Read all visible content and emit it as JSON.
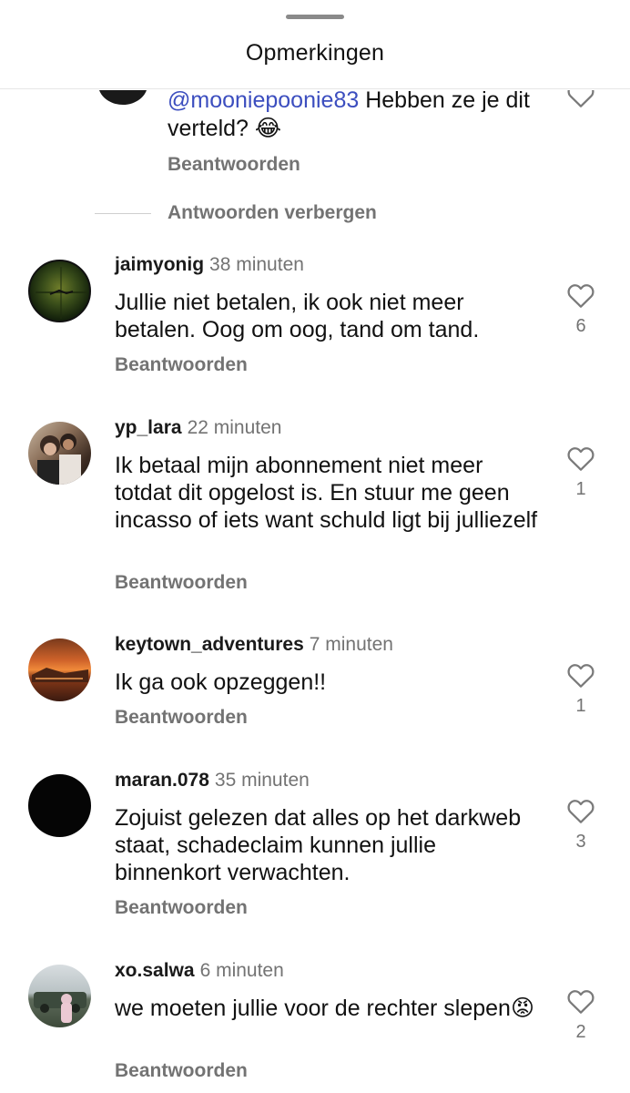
{
  "header": {
    "title": "Opmerkingen"
  },
  "reply": {
    "mention": "@mooniepoonie83",
    "text": " Hebben ze je dit verteld? 😂",
    "reply_label": "Beantwoorden",
    "hide_replies_label": "Antwoorden verbergen"
  },
  "comments": [
    {
      "user": "jaimyonig",
      "time": "38 minuten",
      "text": "Jullie niet betalen, ik ook niet meer betalen. Oog om oog, tand om tand.",
      "likes": "6",
      "reply_label": "Beantwoorden"
    },
    {
      "user": "yp_lara",
      "time": "22 minuten",
      "text": "Ik betaal mijn abonnement niet meer totdat dit opgelost is. En stuur me geen incasso of iets want schuld ligt bij julliezelf",
      "likes": "1",
      "reply_label": "Beantwoorden"
    },
    {
      "user": "keytown_adventures",
      "time": "7 minuten",
      "text": "Ik ga ook opzeggen!!",
      "likes": "1",
      "reply_label": "Beantwoorden"
    },
    {
      "user": "maran.078",
      "time": "35 minuten",
      "text": "Zojuist gelezen dat alles op het darkweb staat, schadeclaim kunnen jullie binnenkort verwachten.",
      "likes": "3",
      "reply_label": "Beantwoorden"
    },
    {
      "user": "xo.salwa",
      "time": "6 minuten",
      "text": "we moeten jullie voor de rechter slepen😡",
      "likes": "2",
      "reply_label": "Beantwoorden"
    }
  ],
  "colors": {
    "link": "#3c4ebf",
    "muted": "#737373",
    "text": "#111111"
  }
}
